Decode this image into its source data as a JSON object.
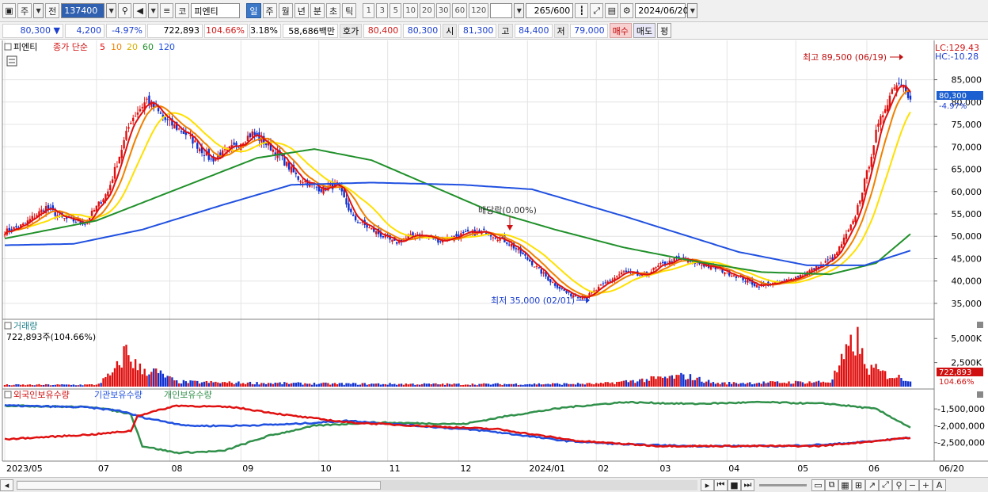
{
  "toolbar": {
    "period_label": "주",
    "prev_label": "전",
    "code": "137400",
    "market_label": "코",
    "stock_name": "피엔티",
    "tf_day": "일",
    "tf_week": "주",
    "tf_month": "월",
    "tf_year": "년",
    "tf_min": "분",
    "tf_sec": "초",
    "tf_tick": "틱",
    "intervals": [
      "1",
      "3",
      "5",
      "10",
      "20",
      "30",
      "60",
      "120"
    ],
    "count": "265",
    "count_total": "/600",
    "date": "2024/06/20"
  },
  "quote": {
    "price": "80,300",
    "down_arrow": "▼",
    "change": "4,200",
    "change_pct": "-4.97%",
    "volume": "722,893",
    "volume_ratio": "104.66%",
    "turnover": "3.18%",
    "amount": "58,686백만",
    "ask_label": "호가",
    "ask": "80,400",
    "bid": "80,300",
    "open_label": "시",
    "open": "81,300",
    "high_label": "고",
    "high": "84,400",
    "low_label": "저",
    "low": "79,000",
    "buy_label": "매수",
    "sell_label": "매도",
    "eval_label": "평"
  },
  "price_pane": {
    "name": "피엔티",
    "ma_label": "종가 단순",
    "ma_periods": [
      "5",
      "10",
      "20",
      "60",
      "120"
    ],
    "lc": "LC:129.43",
    "hc": "HC:-10.28",
    "current": "80,300",
    "current_pct": "-4.97%",
    "high_annot": "최고 89,500 (06/19)",
    "low_annot": "최저 35,000 (02/01)",
    "div_annot": "배당락(0.00%)",
    "y_ticks": [
      "85,000",
      "80,000",
      "75,000",
      "70,000",
      "65,000",
      "60,000",
      "55,000",
      "50,000",
      "45,000",
      "40,000",
      "35,000"
    ]
  },
  "volume_pane": {
    "title": "거래량",
    "value_text": "722,893주(104.66%)",
    "y_ticks": [
      "5,000K",
      "2,500K"
    ],
    "current": "722,893",
    "current_pct": "104.66%"
  },
  "holdings_pane": {
    "series": [
      "외국인보유수량",
      "기관보유수량",
      "개인보유수량"
    ],
    "y_ticks": [
      "-1,500,000",
      "-2,000,000",
      "-2,500,000"
    ]
  },
  "x_axis": [
    "2023/05",
    "07",
    "08",
    "09",
    "10",
    "11",
    "12",
    "2024/01",
    "02",
    "03",
    "04",
    "05",
    "06",
    "06/20"
  ],
  "colors": {
    "ma5": "#e01010",
    "ma10": "#f08000",
    "ma20": "#ffe000",
    "ma60": "#20902a",
    "ma120": "#2050e0",
    "up": "#e01010",
    "down": "#1030d0",
    "foreign": "#e01010",
    "inst": "#2050e0",
    "indiv": "#30904a"
  },
  "chart_data": {
    "type": "candlestick",
    "price_anchors": [
      [
        0,
        51000
      ],
      [
        8,
        52500
      ],
      [
        18,
        56500
      ],
      [
        25,
        54000
      ],
      [
        35,
        53000
      ],
      [
        45,
        60000
      ],
      [
        55,
        76000
      ],
      [
        62,
        80500
      ],
      [
        70,
        76000
      ],
      [
        80,
        72500
      ],
      [
        90,
        67000
      ],
      [
        100,
        70000
      ],
      [
        108,
        73000
      ],
      [
        118,
        69000
      ],
      [
        128,
        63000
      ],
      [
        138,
        60500
      ],
      [
        145,
        61500
      ],
      [
        152,
        54000
      ],
      [
        160,
        51500
      ],
      [
        170,
        48500
      ],
      [
        180,
        50500
      ],
      [
        190,
        49000
      ],
      [
        200,
        50500
      ],
      [
        210,
        51000
      ],
      [
        220,
        48500
      ],
      [
        230,
        44000
      ],
      [
        238,
        40000
      ],
      [
        246,
        37000
      ],
      [
        254,
        36500
      ],
      [
        262,
        39500
      ],
      [
        270,
        42000
      ],
      [
        278,
        41000
      ],
      [
        286,
        43500
      ],
      [
        294,
        45000
      ],
      [
        302,
        44000
      ],
      [
        312,
        42500
      ],
      [
        320,
        41000
      ],
      [
        328,
        39000
      ],
      [
        338,
        39500
      ],
      [
        348,
        41500
      ],
      [
        356,
        43500
      ],
      [
        362,
        45500
      ],
      [
        370,
        53000
      ],
      [
        376,
        64000
      ],
      [
        380,
        73000
      ],
      [
        384,
        79000
      ],
      [
        388,
        84000
      ],
      [
        392,
        84500
      ],
      [
        395,
        80300
      ]
    ],
    "ma60_anchors": [
      [
        0,
        49500
      ],
      [
        40,
        53500
      ],
      [
        80,
        61500
      ],
      [
        110,
        67500
      ],
      [
        135,
        69500
      ],
      [
        160,
        67000
      ],
      [
        185,
        61500
      ],
      [
        210,
        56000
      ],
      [
        240,
        51500
      ],
      [
        270,
        47500
      ],
      [
        300,
        44500
      ],
      [
        330,
        42000
      ],
      [
        360,
        41500
      ],
      [
        380,
        44000
      ],
      [
        395,
        50500
      ]
    ],
    "ma120_anchors": [
      [
        0,
        48000
      ],
      [
        30,
        48300
      ],
      [
        60,
        51500
      ],
      [
        95,
        57000
      ],
      [
        125,
        61500
      ],
      [
        160,
        62000
      ],
      [
        200,
        61500
      ],
      [
        230,
        60500
      ],
      [
        270,
        54500
      ],
      [
        320,
        46500
      ],
      [
        350,
        43500
      ],
      [
        375,
        43500
      ],
      [
        395,
        46800
      ]
    ],
    "volume_anchors": [
      [
        0,
        180
      ],
      [
        40,
        200
      ],
      [
        48,
        1500
      ],
      [
        53,
        3800
      ],
      [
        58,
        1900
      ],
      [
        66,
        1500
      ],
      [
        75,
        500
      ],
      [
        100,
        400
      ],
      [
        140,
        300
      ],
      [
        200,
        250
      ],
      [
        260,
        300
      ],
      [
        297,
        1100
      ],
      [
        310,
        350
      ],
      [
        360,
        500
      ],
      [
        372,
        5200
      ],
      [
        375,
        2000
      ],
      [
        380,
        1700
      ],
      [
        385,
        1200
      ],
      [
        395,
        720
      ]
    ],
    "foreign_anchors": [
      [
        0,
        -2400000
      ],
      [
        40,
        -2250000
      ],
      [
        55,
        -2150000
      ],
      [
        58,
        -1700000
      ],
      [
        75,
        -1400000
      ],
      [
        100,
        -1450000
      ],
      [
        125,
        -1700000
      ],
      [
        150,
        -1900000
      ],
      [
        180,
        -2000000
      ],
      [
        215,
        -2100000
      ],
      [
        250,
        -2450000
      ],
      [
        285,
        -2600000
      ],
      [
        320,
        -2600000
      ],
      [
        355,
        -2600000
      ],
      [
        380,
        -2450000
      ],
      [
        395,
        -2350000
      ]
    ],
    "inst_anchors": [
      [
        0,
        -1400000
      ],
      [
        35,
        -1450000
      ],
      [
        50,
        -1550000
      ],
      [
        60,
        -1750000
      ],
      [
        80,
        -2000000
      ],
      [
        100,
        -2000000
      ],
      [
        125,
        -1950000
      ],
      [
        150,
        -1850000
      ],
      [
        180,
        -2000000
      ],
      [
        210,
        -2150000
      ],
      [
        245,
        -2450000
      ],
      [
        270,
        -2550000
      ],
      [
        300,
        -2600000
      ],
      [
        340,
        -2600000
      ],
      [
        360,
        -2550000
      ],
      [
        380,
        -2450000
      ],
      [
        395,
        -2350000
      ]
    ],
    "indiv_anchors": [
      [
        0,
        -1400000
      ],
      [
        40,
        -1450000
      ],
      [
        55,
        -1650000
      ],
      [
        60,
        -2600000
      ],
      [
        75,
        -2800000
      ],
      [
        95,
        -2750000
      ],
      [
        115,
        -2300000
      ],
      [
        135,
        -2000000
      ],
      [
        160,
        -1900000
      ],
      [
        200,
        -1950000
      ],
      [
        220,
        -1700000
      ],
      [
        245,
        -1450000
      ],
      [
        270,
        -1300000
      ],
      [
        300,
        -1350000
      ],
      [
        330,
        -1300000
      ],
      [
        360,
        -1350000
      ],
      [
        380,
        -1500000
      ],
      [
        395,
        -2050000
      ]
    ]
  }
}
